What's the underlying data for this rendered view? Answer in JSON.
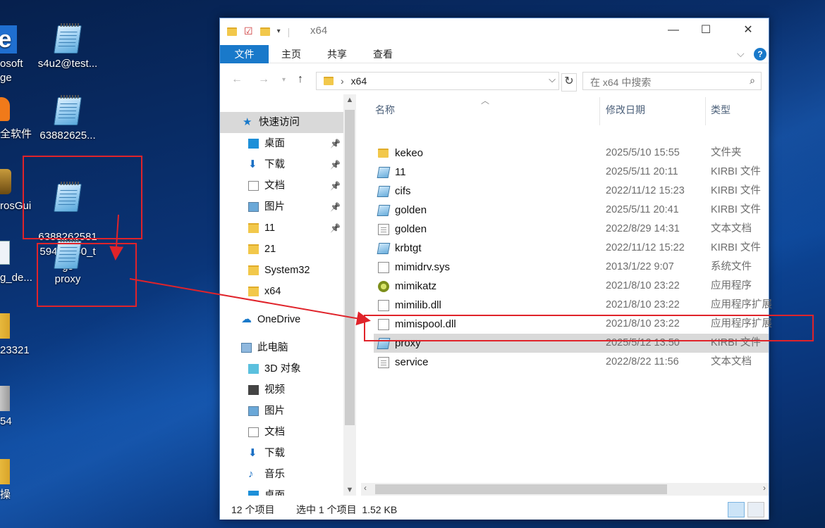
{
  "desktop": {
    "icons": [
      {
        "label": "s4u2@test..."
      },
      {
        "label": "63882625..."
      },
      {
        "label": "6388262581\n59443940_t\ngs"
      },
      {
        "label": "proxy"
      }
    ],
    "cut_labels": [
      "osoft",
      "ge",
      "全软件",
      "rosGui",
      "g_de...",
      "23321",
      "54",
      "操"
    ]
  },
  "explorer": {
    "title": "x64",
    "ribbon_tabs": [
      "文件",
      "主页",
      "共享",
      "查看"
    ],
    "address": {
      "crumb": "x64"
    },
    "search": {
      "placeholder": "在 x64 中搜索"
    },
    "nav": [
      {
        "label": "快速访问",
        "icon": "star-icon",
        "pinned": false,
        "selected": true
      },
      {
        "label": "桌面",
        "icon": "desktop-icon",
        "pinned": true
      },
      {
        "label": "下载",
        "icon": "download-icon",
        "pinned": true
      },
      {
        "label": "文档",
        "icon": "documents-icon",
        "pinned": true
      },
      {
        "label": "图片",
        "icon": "pictures-icon",
        "pinned": true
      },
      {
        "label": "11",
        "icon": "folder-icon",
        "pinned": true
      },
      {
        "label": "21",
        "icon": "folder-icon",
        "pinned": false
      },
      {
        "label": "System32",
        "icon": "folder-icon",
        "pinned": false
      },
      {
        "label": "x64",
        "icon": "folder-icon",
        "pinned": false
      },
      {
        "label": "OneDrive",
        "icon": "cloud-icon",
        "pinned": false
      },
      {
        "label": "此电脑",
        "icon": "computer-icon",
        "pinned": false
      },
      {
        "label": "3D 对象",
        "icon": "cube-icon",
        "pinned": false
      },
      {
        "label": "视频",
        "icon": "video-icon",
        "pinned": false
      },
      {
        "label": "图片",
        "icon": "pictures-icon",
        "pinned": false
      },
      {
        "label": "文档",
        "icon": "documents-icon",
        "pinned": false
      },
      {
        "label": "下载",
        "icon": "download-icon",
        "pinned": false
      },
      {
        "label": "音乐",
        "icon": "music-icon",
        "pinned": false
      },
      {
        "label": "桌面",
        "icon": "desktop-icon",
        "pinned": false
      }
    ],
    "columns": {
      "name": "名称",
      "date": "修改日期",
      "type": "类型"
    },
    "files": [
      {
        "name": "kekeo",
        "date": "2025/5/10 15:55",
        "type": "文件夹",
        "icon": "folder-icon"
      },
      {
        "name": "11",
        "date": "2025/5/11 20:11",
        "type": "KIRBI 文件",
        "icon": "kirbi-file-icon"
      },
      {
        "name": "cifs",
        "date": "2022/11/12 15:23",
        "type": "KIRBI 文件",
        "icon": "kirbi-file-icon"
      },
      {
        "name": "golden",
        "date": "2025/5/11 20:41",
        "type": "KIRBI 文件",
        "icon": "kirbi-file-icon"
      },
      {
        "name": "golden",
        "date": "2022/8/29 14:31",
        "type": "文本文档",
        "icon": "text-file-icon"
      },
      {
        "name": "krbtgt",
        "date": "2022/11/12 15:22",
        "type": "KIRBI 文件",
        "icon": "kirbi-file-icon"
      },
      {
        "name": "mimidrv.sys",
        "date": "2013/1/22 9:07",
        "type": "系统文件",
        "icon": "system-file-icon"
      },
      {
        "name": "mimikatz",
        "date": "2021/8/10 23:22",
        "type": "应用程序",
        "icon": "exe-icon"
      },
      {
        "name": "mimilib.dll",
        "date": "2021/8/10 23:22",
        "type": "应用程序扩展",
        "icon": "dll-icon"
      },
      {
        "name": "mimispool.dll",
        "date": "2021/8/10 23:22",
        "type": "应用程序扩展",
        "icon": "dll-icon"
      },
      {
        "name": "proxy",
        "date": "2025/5/12 13:50",
        "type": "KIRBI 文件",
        "icon": "kirbi-file-icon",
        "selected": true
      },
      {
        "name": "service",
        "date": "2022/8/22 11:56",
        "type": "文本文档",
        "icon": "text-file-icon"
      }
    ],
    "status": {
      "count": "12 个项目",
      "selection": "选中 1 个项目  1.52 KB"
    }
  },
  "colors": {
    "accent": "#1979ca",
    "annotation": "#e0232a",
    "selection": "#d9d9d9"
  }
}
